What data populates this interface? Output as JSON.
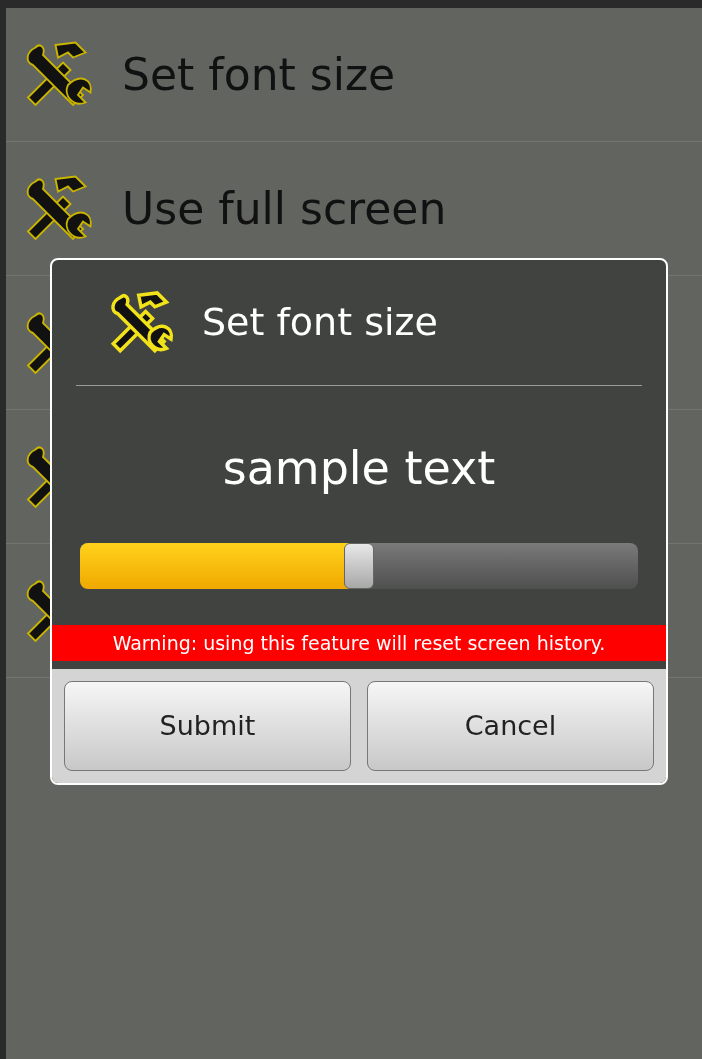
{
  "settings_list": {
    "items": [
      {
        "label": "Set font size"
      },
      {
        "label": "Use full screen"
      }
    ]
  },
  "dialog": {
    "title": "Set font size",
    "sample": "sample text",
    "slider": {
      "level": 0.5
    },
    "warning": "Warning: using this feature will reset screen history.",
    "buttons": [
      "Submit",
      "Cancel"
    ]
  }
}
